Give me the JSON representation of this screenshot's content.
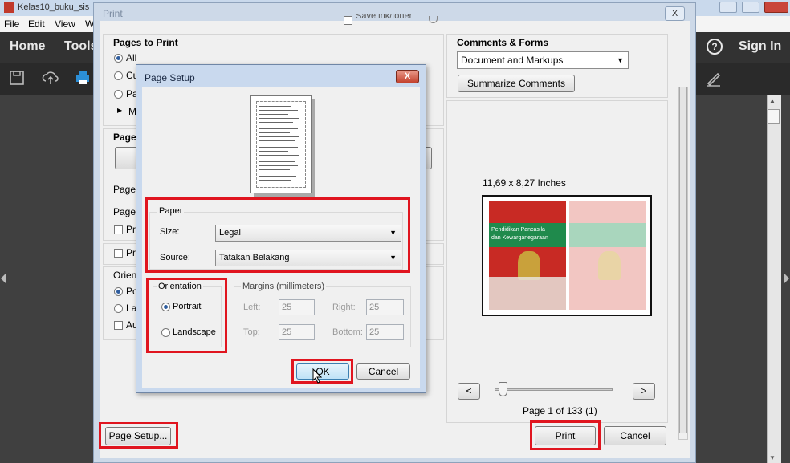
{
  "app": {
    "window_title": "Kelas10_buku_sis",
    "menu": [
      "File",
      "Edit",
      "View",
      "W"
    ],
    "nav": {
      "home": "Home",
      "tools": "Tools",
      "sign_in": "Sign In"
    }
  },
  "print_dialog": {
    "title": "Print",
    "close_label": "X",
    "top_checkbox_partial": "Save ink/toner",
    "pages_to_print": {
      "title": "Pages to Print",
      "options": [
        "All",
        "Cu",
        "Pa"
      ],
      "more": "M",
      "selected": "All"
    },
    "page_sizing": {
      "title": "Page",
      "labels": [
        "Pages",
        "Page",
        "Pri",
        "Pri"
      ]
    },
    "orientation": {
      "title": "Orien",
      "options": [
        "Po",
        "La",
        "Au"
      ]
    },
    "comments_forms": {
      "title": "Comments & Forms",
      "selected": "Document and Markups",
      "summarize_button": "Summarize Comments"
    },
    "preview": {
      "size_label": "11,69 x 8,27 Inches",
      "book_title_line1": "Pendidikan Pancasila",
      "book_title_line2": "dan Kewarganegaraan",
      "prev_button": "<",
      "next_button": ">",
      "page_indicator": "Page 1 of 133 (1)",
      "slider_position": 0
    },
    "buttons": {
      "page_setup": "Page Setup...",
      "print": "Print",
      "cancel": "Cancel"
    }
  },
  "page_setup": {
    "title": "Page Setup",
    "close_label": "X",
    "paper": {
      "legend": "Paper",
      "size_label": "Size:",
      "size_value": "Legal",
      "source_label": "Source:",
      "source_value": "Tatakan Belakang"
    },
    "orientation": {
      "legend": "Orientation",
      "portrait": "Portrait",
      "landscape": "Landscape",
      "selected": "Portrait"
    },
    "margins": {
      "legend": "Margins (millimeters)",
      "left_label": "Left:",
      "left": "25",
      "right_label": "Right:",
      "right": "25",
      "top_label": "Top:",
      "top": "25",
      "bottom_label": "Bottom:",
      "bottom": "25"
    },
    "ok_button": "OK",
    "cancel_button": "Cancel"
  },
  "colors": {
    "highlight_red": "#e0151f",
    "book_red": "#c82a24",
    "book_green": "#1f8a4c",
    "dialog_blue": "#c9d9ee"
  }
}
